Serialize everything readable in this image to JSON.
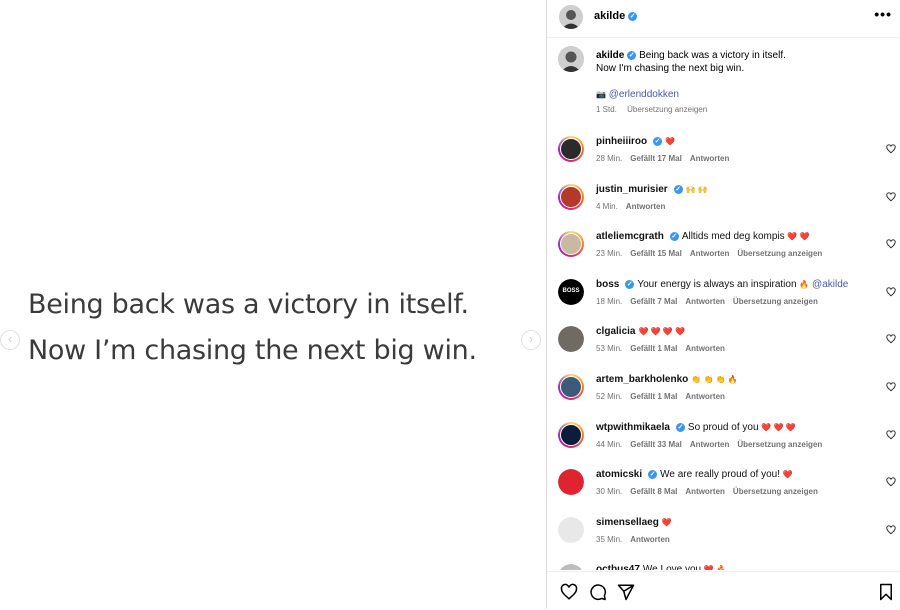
{
  "post": {
    "big_caption_line1": "Being back was a victory in itself.",
    "big_caption_line2": "Now I’m chasing the next big win."
  },
  "header": {
    "username": "akilde",
    "more_label": "•••"
  },
  "caption": {
    "username": "akilde",
    "line1": "Being back was a victory in itself.",
    "line2": "Now I'm chasing the next big win.",
    "camera_emoji": "📷",
    "mention": "@erlenddokken",
    "time": "1 Std.",
    "translate": "Übersetzung anzeigen"
  },
  "comments": [
    {
      "user": "pinheiiiroo",
      "verified": true,
      "text": "",
      "emoji": "❤️",
      "time": "28 Min.",
      "likes": "Gefällt 17 Mal",
      "reply": "Antworten",
      "translate": "",
      "avatar_bg": "#2b2b2b",
      "ring": true
    },
    {
      "user": "justin_murisier",
      "verified": true,
      "text": "",
      "emoji": "🙌 🙌",
      "time": "4 Min.",
      "likes": "",
      "reply": "Antworten",
      "translate": "",
      "avatar_bg": "#b33a2a",
      "ring": true
    },
    {
      "user": "atleliemcgrath",
      "verified": true,
      "text": "Alltids med deg kompis",
      "emoji": "❤️ ❤️",
      "time": "23 Min.",
      "likes": "Gefällt 15 Mal",
      "reply": "Antworten",
      "translate": "Übersetzung anzeigen",
      "avatar_bg": "#c9b8a2",
      "ring": true
    },
    {
      "user": "boss",
      "verified": true,
      "text": "Your energy is always an inspiration",
      "emoji": "🔥",
      "mention": "@akilde",
      "time": "18 Min.",
      "likes": "Gefällt 7 Mal",
      "reply": "Antworten",
      "translate": "Übersetzung anzeigen",
      "avatar_bg": "#000000",
      "avatar_text": "BOSS",
      "ring": false
    },
    {
      "user": "clgalicia",
      "verified": false,
      "text": "",
      "emoji": "❤️ ❤️ ❤️ ❤️",
      "time": "53 Min.",
      "likes": "Gefällt 1 Mal",
      "reply": "Antworten",
      "translate": "",
      "avatar_bg": "#6f6a62",
      "ring": false
    },
    {
      "user": "artem_barkholenko",
      "verified": false,
      "text": "",
      "emoji": "👏 👏 👏 🔥",
      "time": "52 Min.",
      "likes": "Gefällt 1 Mal",
      "reply": "Antworten",
      "translate": "",
      "avatar_bg": "#3d5a7a",
      "ring": true
    },
    {
      "user": "wtpwithmikaela",
      "verified": true,
      "text": "So proud of you",
      "emoji": "❤️ ❤️ ❤️",
      "time": "44 Min.",
      "likes": "Gefällt 33 Mal",
      "reply": "Antworten",
      "translate": "Übersetzung anzeigen",
      "avatar_bg": "#0b1d3a",
      "ring": true
    },
    {
      "user": "atomicski",
      "verified": true,
      "text": "We are really proud of you!",
      "emoji": "❤️",
      "time": "30 Min.",
      "likes": "Gefällt 8 Mal",
      "reply": "Antworten",
      "translate": "Übersetzung anzeigen",
      "avatar_bg": "#e0242f",
      "ring": false
    },
    {
      "user": "simensellaeg",
      "verified": false,
      "text": "",
      "emoji": "❤️",
      "time": "35 Min.",
      "likes": "",
      "reply": "Antworten",
      "translate": "",
      "avatar_bg": "#e8e8e8",
      "ring": false
    },
    {
      "user": "octbus47",
      "verified": false,
      "text": "We Love you",
      "emoji": "❤️ 🔥",
      "time": "",
      "likes": "",
      "reply": "",
      "translate": "",
      "avatar_bg": "#bdbdbd",
      "ring": false
    }
  ],
  "actions": {
    "like_icon": "heart-icon",
    "comment_icon": "comment-icon",
    "share_icon": "send-icon",
    "save_icon": "bookmark-icon"
  },
  "colors": {
    "verified": "#3897f0",
    "heart": "#e3263d",
    "mention": "#4a5aa8"
  }
}
